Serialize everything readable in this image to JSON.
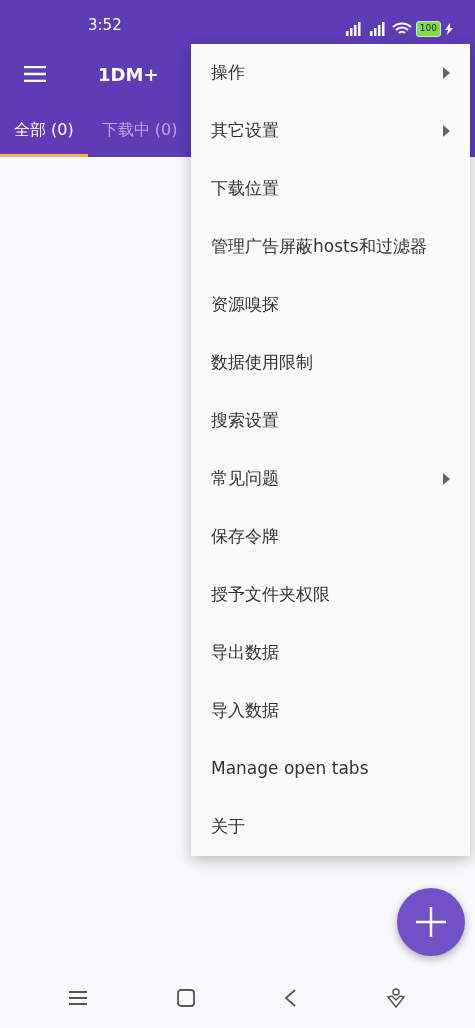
{
  "status_bar": {
    "time": "3:52",
    "battery": "100"
  },
  "toolbar": {
    "title": "1DM+"
  },
  "tabs": [
    {
      "label": "全部 (0)",
      "selected": true
    },
    {
      "label": "下载中 (0)",
      "selected": false
    }
  ],
  "menu": [
    {
      "label": "操作",
      "kind": "submenu"
    },
    {
      "label": "其它设置",
      "kind": "submenu"
    },
    {
      "label": "下载位置",
      "kind": "plain"
    },
    {
      "label": "管理广告屏蔽hosts和过滤器",
      "kind": "plain"
    },
    {
      "label": "资源嗅探",
      "kind": "plain"
    },
    {
      "label": "数据使用限制",
      "kind": "plain"
    },
    {
      "label": "搜索设置",
      "kind": "plain"
    },
    {
      "label": "常见问题",
      "kind": "submenu"
    },
    {
      "label": "保存令牌",
      "kind": "plain"
    },
    {
      "label": "授予文件夹权限",
      "kind": "plain"
    },
    {
      "label": "导出数据",
      "kind": "plain"
    },
    {
      "label": "导入数据",
      "kind": "plain"
    },
    {
      "label": "Manage open tabs",
      "kind": "plain"
    },
    {
      "label": "关于",
      "kind": "plain"
    }
  ]
}
